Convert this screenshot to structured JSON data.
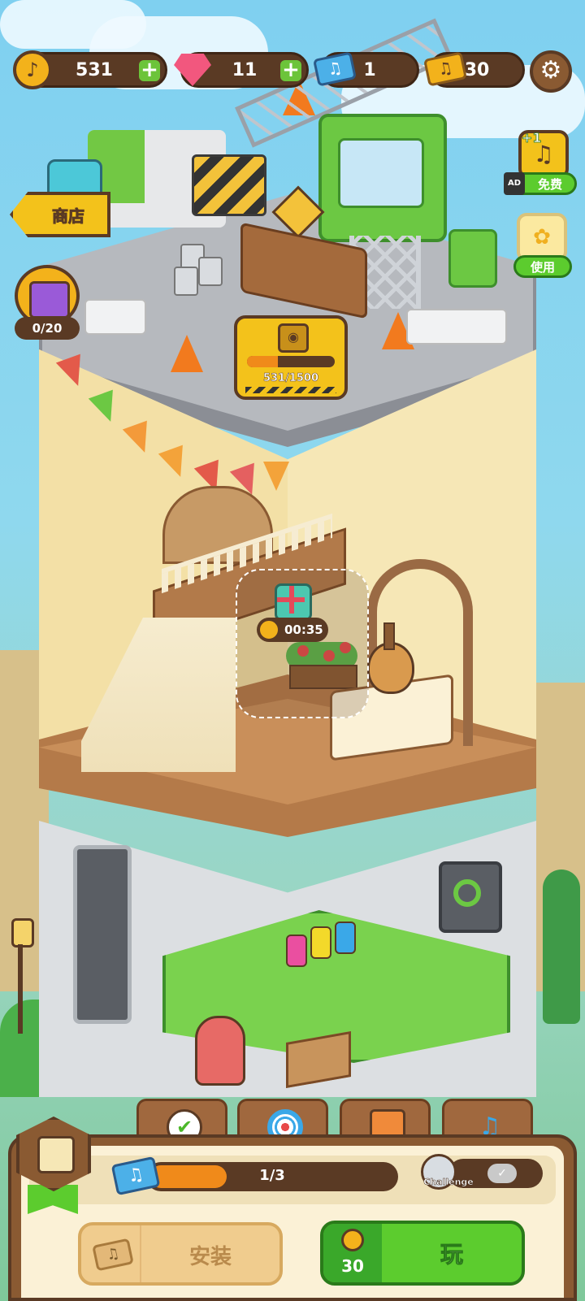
{
  "resources": {
    "coins": "531",
    "gems": "11",
    "tickets": "1",
    "golden_tickets": "30"
  },
  "side": {
    "shop_label": "商店",
    "chest_count": "0/20",
    "free_badge": "+1",
    "free_label": "免费",
    "ad_label": "AD",
    "use_label": "使用"
  },
  "construction": {
    "progress_text": "531/1500",
    "progress_fraction": 0.354
  },
  "gift": {
    "timer": "00:35"
  },
  "bottom": {
    "progress_text": "1/3",
    "progress_fraction": 0.333,
    "challenge_label": "Challenge",
    "install_label": "安装",
    "play_label": "玩",
    "play_cost": "30"
  },
  "colors": {
    "accent_green": "#5ccc2e",
    "brown": "#5a3a24",
    "gold": "#f3b21b",
    "orange_progress": "#f08a1a"
  }
}
